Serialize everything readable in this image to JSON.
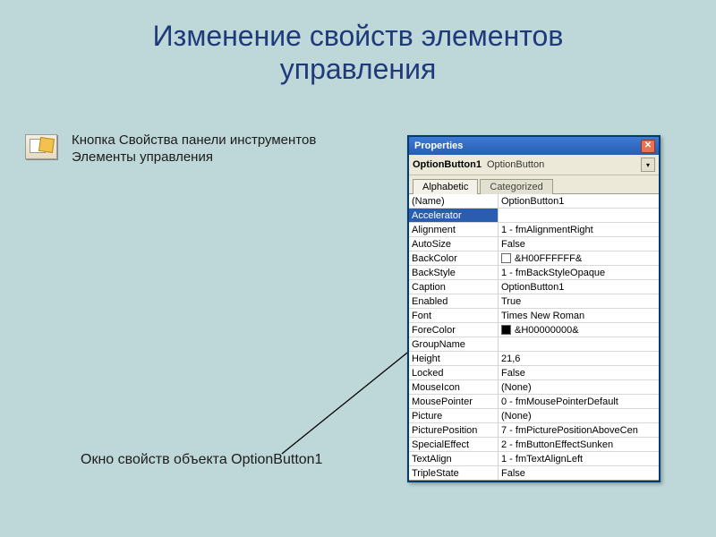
{
  "slide": {
    "title_line1": "Изменение свойств элементов",
    "title_line2": "управления",
    "toolbar_desc": "Кнопка Свойства панели инструментов Элементы управления",
    "caption": "Окно свойств объекта OptionButton1"
  },
  "properties_window": {
    "title": "Properties",
    "selector": {
      "name": "OptionButton1",
      "type": "OptionButton"
    },
    "tabs": {
      "alphabetic": "Alphabetic",
      "categorized": "Categorized",
      "active": "alphabetic"
    },
    "selected_row": "Accelerator",
    "rows": [
      {
        "name": "(Name)",
        "value": "OptionButton1"
      },
      {
        "name": "Accelerator",
        "value": ""
      },
      {
        "name": "Alignment",
        "value": "1 - fmAlignmentRight"
      },
      {
        "name": "AutoSize",
        "value": "False"
      },
      {
        "name": "BackColor",
        "value": "&H00FFFFFF&",
        "swatch": "#ffffff"
      },
      {
        "name": "BackStyle",
        "value": "1 - fmBackStyleOpaque"
      },
      {
        "name": "Caption",
        "value": "OptionButton1"
      },
      {
        "name": "Enabled",
        "value": "True"
      },
      {
        "name": "Font",
        "value": "Times New Roman"
      },
      {
        "name": "ForeColor",
        "value": "&H00000000&",
        "swatch": "#000000"
      },
      {
        "name": "GroupName",
        "value": ""
      },
      {
        "name": "Height",
        "value": "21,6"
      },
      {
        "name": "Locked",
        "value": "False"
      },
      {
        "name": "MouseIcon",
        "value": "(None)"
      },
      {
        "name": "MousePointer",
        "value": "0 - fmMousePointerDefault"
      },
      {
        "name": "Picture",
        "value": "(None)"
      },
      {
        "name": "PicturePosition",
        "value": "7 - fmPicturePositionAboveCen"
      },
      {
        "name": "SpecialEffect",
        "value": "2 - fmButtonEffectSunken"
      },
      {
        "name": "TextAlign",
        "value": "1 - fmTextAlignLeft"
      },
      {
        "name": "TripleState",
        "value": "False"
      }
    ]
  }
}
